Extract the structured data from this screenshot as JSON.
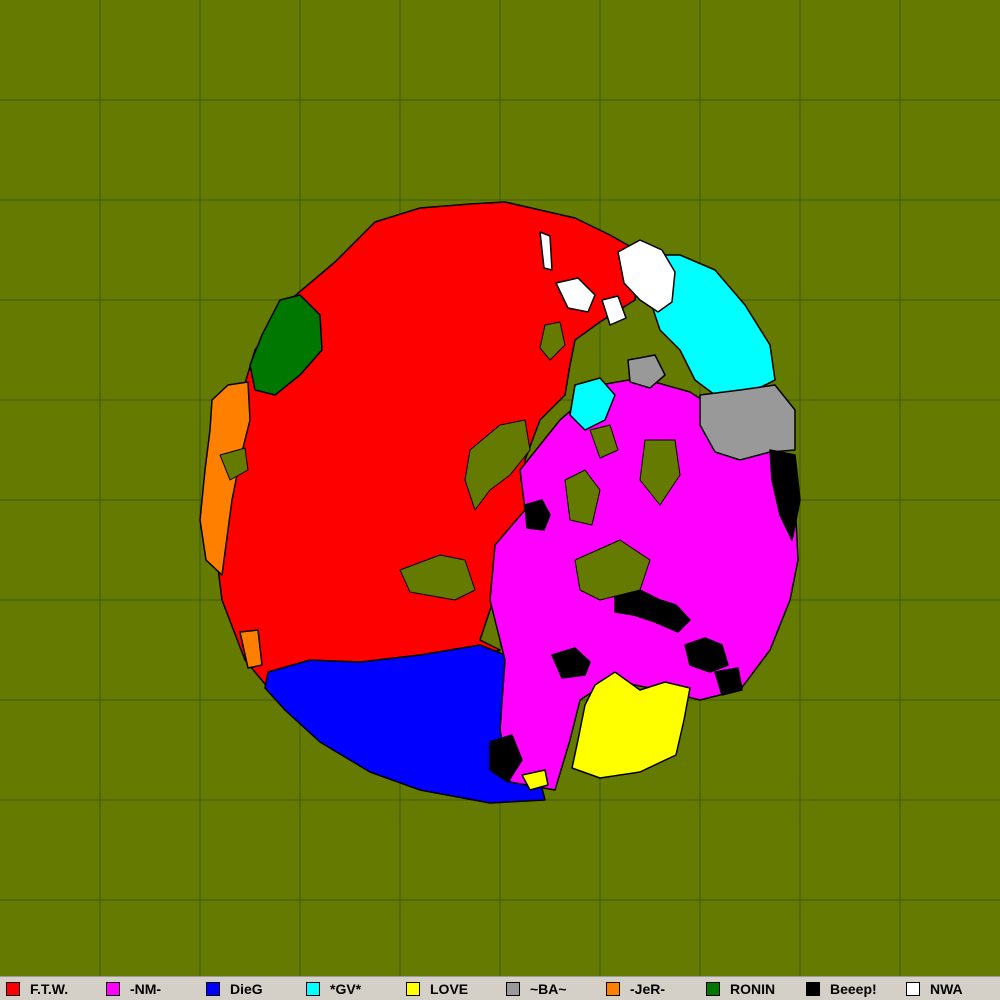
{
  "map": {
    "background": "#657a00",
    "grid_color": "#3d5a14",
    "border_color": "#000000"
  },
  "legend": {
    "items": [
      {
        "name": "F.T.W.",
        "color": "#ff0000"
      },
      {
        "name": "-NM-",
        "color": "#ff00ff"
      },
      {
        "name": "DieG",
        "color": "#0000ff"
      },
      {
        "name": "*GV*",
        "color": "#00ffff"
      },
      {
        "name": "LOVE",
        "color": "#ffff00"
      },
      {
        "name": "~BA~",
        "color": "#999999"
      },
      {
        "name": "-JeR-",
        "color": "#ff8000"
      },
      {
        "name": "RONIN",
        "color": "#007700"
      },
      {
        "name": "Beeep!",
        "color": "#000000"
      },
      {
        "name": "NWA",
        "color": "#ffffff"
      }
    ]
  }
}
